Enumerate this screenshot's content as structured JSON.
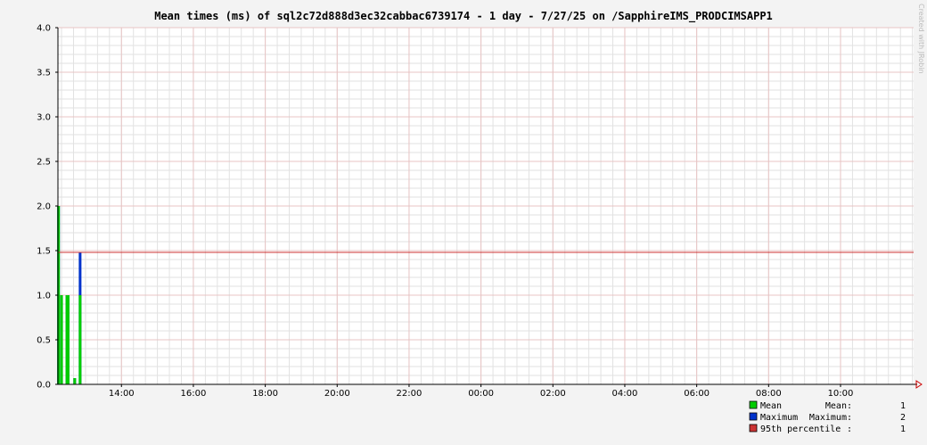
{
  "chart_data": {
    "type": "bar",
    "title": "Mean times (ms) of sql2c72d888d3ec32cabbac6739174 - 1 day - 7/27/25 on /SapphireIMS_PRODCIMSAPP1",
    "xlabel": "",
    "ylabel": "",
    "ylim": [
      0,
      4.0
    ],
    "yticks": [
      "0.0",
      "0.5",
      "1.0",
      "1.5",
      "2.0",
      "2.5",
      "3.0",
      "3.5",
      "4.0"
    ],
    "xlim": [
      "12:14",
      "12:02"
    ],
    "xticks": [
      "14:00",
      "16:00",
      "18:00",
      "20:00",
      "22:00",
      "00:00",
      "02:00",
      "04:00",
      "06:00",
      "08:00",
      "10:00"
    ],
    "percentile_95": 1.48,
    "series": [
      {
        "name": "Mean",
        "color": "#00cc00",
        "points": [
          {
            "time": "12:15",
            "value": 2.0
          },
          {
            "time": "12:20",
            "value": 1.0
          },
          {
            "time": "12:29",
            "value": 1.0
          },
          {
            "time": "12:31",
            "value": 1.0
          },
          {
            "time": "12:42",
            "value": 0.07
          },
          {
            "time": "12:51",
            "value": 1.0
          }
        ]
      },
      {
        "name": "Maximum",
        "color": "#0033cc",
        "points": [
          {
            "time": "12:15",
            "value": 2.0
          },
          {
            "time": "12:20",
            "value": 1.0
          },
          {
            "time": "12:29",
            "value": 1.0
          },
          {
            "time": "12:31",
            "value": 1.0
          },
          {
            "time": "12:42",
            "value": 0.07
          },
          {
            "time": "12:51",
            "value": 1.48
          }
        ]
      }
    ],
    "legend": {
      "placement": "bottom-right",
      "entries": [
        {
          "key": "mean",
          "label": "Mean",
          "stat": "Mean:",
          "value": "1",
          "color": "#00cc00"
        },
        {
          "key": "maximum",
          "label": "Maximum",
          "stat": "Maximum:",
          "value": "2",
          "color": "#0033cc"
        },
        {
          "key": "p95",
          "label": "95th percentile",
          "stat": ":",
          "value": "1",
          "color": "#cc3333"
        }
      ]
    },
    "watermark": "Created with JRobin"
  }
}
